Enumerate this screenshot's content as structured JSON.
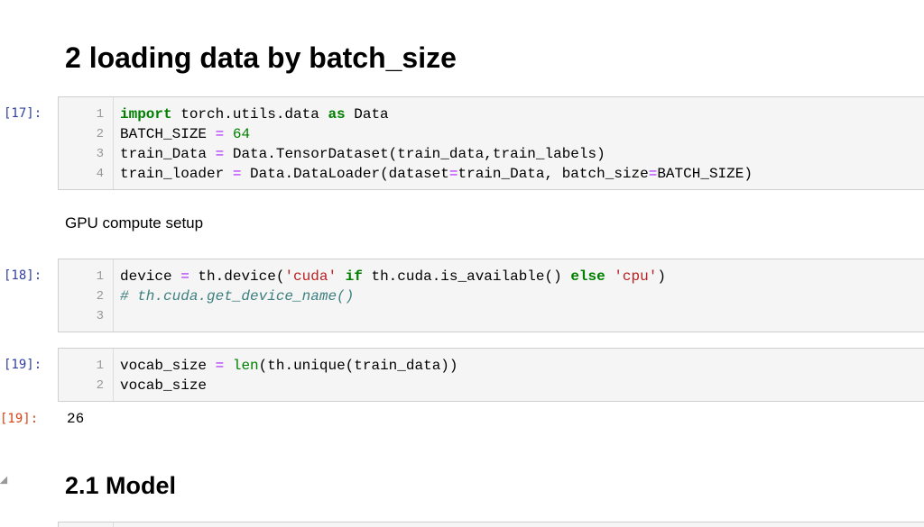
{
  "headings": {
    "section": "2  loading data by batch_size",
    "subsection": "2.1  Model"
  },
  "cells": {
    "c17": {
      "prompt": "[17]:",
      "lines": [
        {
          "n": "1",
          "parts": [
            [
              "kw",
              "import"
            ],
            [
              "",
              " torch.utils.data "
            ],
            [
              "kw",
              "as"
            ],
            [
              "",
              " Data"
            ]
          ]
        },
        {
          "n": "2",
          "parts": [
            [
              "",
              "BATCH_SIZE "
            ],
            [
              "op",
              "="
            ],
            [
              "",
              " "
            ],
            [
              "num",
              "64"
            ]
          ]
        },
        {
          "n": "3",
          "parts": [
            [
              "",
              "train_Data "
            ],
            [
              "op",
              "="
            ],
            [
              "",
              " Data.TensorDataset(train_data,train_labels)"
            ]
          ]
        },
        {
          "n": "4",
          "parts": [
            [
              "",
              "train_loader "
            ],
            [
              "op",
              "="
            ],
            [
              "",
              " Data.DataLoader(dataset"
            ],
            [
              "op",
              "="
            ],
            [
              "",
              "train_Data, batch_size"
            ],
            [
              "op",
              "="
            ],
            [
              "",
              "BATCH_SIZE)"
            ]
          ]
        }
      ]
    },
    "c18": {
      "prompt": "[18]:",
      "lines": [
        {
          "n": "1",
          "parts": [
            [
              "",
              "device "
            ],
            [
              "op",
              "="
            ],
            [
              "",
              " th.device("
            ],
            [
              "str",
              "'cuda'"
            ],
            [
              "",
              " "
            ],
            [
              "kw",
              "if"
            ],
            [
              "",
              " th.cuda.is_available() "
            ],
            [
              "kw",
              "else"
            ],
            [
              "",
              " "
            ],
            [
              "str",
              "'cpu'"
            ],
            [
              "",
              ")"
            ]
          ]
        },
        {
          "n": "2",
          "parts": [
            [
              "cm",
              "# th.cuda.get_device_name()"
            ]
          ]
        },
        {
          "n": "3",
          "parts": [
            [
              "",
              ""
            ]
          ]
        }
      ]
    },
    "c19": {
      "prompt": "[19]:",
      "lines": [
        {
          "n": "1",
          "parts": [
            [
              "",
              "vocab_size "
            ],
            [
              "op",
              "="
            ],
            [
              "",
              " "
            ],
            [
              "bi",
              "len"
            ],
            [
              "",
              "(th.unique(train_data))"
            ]
          ]
        },
        {
          "n": "2",
          "parts": [
            [
              "",
              "vocab_size"
            ]
          ]
        }
      ]
    }
  },
  "markdown": {
    "gpu_setup": "GPU compute setup"
  },
  "output": {
    "prompt": "[19]:",
    "value": "26"
  }
}
